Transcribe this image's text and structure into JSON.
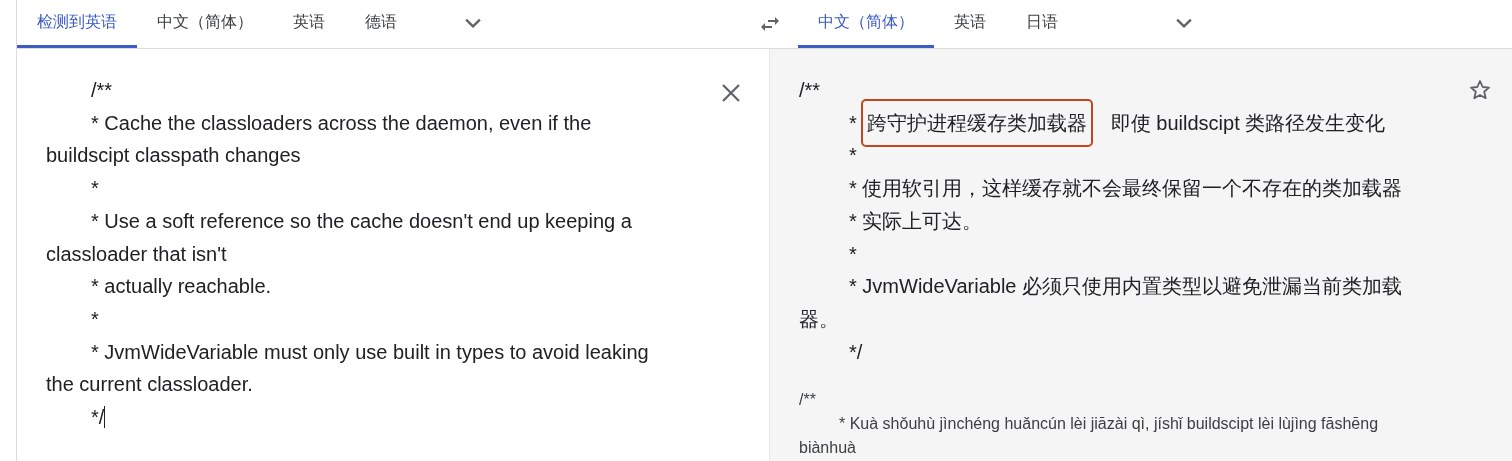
{
  "source_tabs": [
    {
      "label": "检测到英语",
      "selected": true
    },
    {
      "label": "中文（简体）",
      "selected": false
    },
    {
      "label": "英语",
      "selected": false
    },
    {
      "label": "德语",
      "selected": false
    }
  ],
  "target_tabs": [
    {
      "label": "中文（简体）",
      "selected": true
    },
    {
      "label": "英语",
      "selected": false
    },
    {
      "label": "日语",
      "selected": false
    }
  ],
  "source_text": {
    "lines": [
      {
        "text": "/**",
        "indent": true
      },
      {
        "text": "* Cache the classloaders across the daemon, even if the",
        "indent": true
      },
      {
        "text": "buildscipt classpath changes",
        "indent": false
      },
      {
        "text": "*",
        "indent": true
      },
      {
        "text": "* Use a soft reference so the cache doesn't end up keeping a",
        "indent": true
      },
      {
        "text": "classloader that isn't",
        "indent": false
      },
      {
        "text": "* actually reachable.",
        "indent": true
      },
      {
        "text": "*",
        "indent": true
      },
      {
        "text": "* JvmWideVariable must only use built in types to avoid leaking",
        "indent": true
      },
      {
        "text": "the current classloader.",
        "indent": false
      },
      {
        "text": "*/",
        "indent": true
      }
    ]
  },
  "translation": {
    "lines": [
      {
        "indent": false,
        "parts": [
          {
            "text": "/**",
            "highlighted": false
          }
        ]
      },
      {
        "indent": true,
        "parts": [
          {
            "text": "*",
            "highlighted": false
          },
          {
            "text": "跨守护进程缓存类加载器",
            "highlighted": true
          },
          {
            "text": "即使 buildscipt 类路径发生变化",
            "highlighted": false
          }
        ]
      },
      {
        "indent": true,
        "parts": [
          {
            "text": "*",
            "highlighted": false
          }
        ]
      },
      {
        "indent": true,
        "parts": [
          {
            "text": "* 使用软引用，这样缓存就不会最终保留一个不存在的类加载器",
            "highlighted": false
          }
        ]
      },
      {
        "indent": true,
        "parts": [
          {
            "text": "* 实际上可达。",
            "highlighted": false
          }
        ]
      },
      {
        "indent": true,
        "parts": [
          {
            "text": "*",
            "highlighted": false
          }
        ]
      },
      {
        "indent": true,
        "parts": [
          {
            "text": "* JvmWideVariable 必须只使用内置类型以避免泄漏当前类加载",
            "highlighted": false
          }
        ]
      },
      {
        "indent": false,
        "parts": [
          {
            "text": "器。",
            "highlighted": false
          }
        ]
      },
      {
        "indent": true,
        "parts": [
          {
            "text": "*/",
            "highlighted": false
          }
        ]
      }
    ],
    "romanization": {
      "lines": [
        {
          "text": "/**",
          "indent": false
        },
        {
          "text": "* Kuà shǒuhù jìnchéng huǎncún lèi jiāzài qì, jíshǐ buildscipt lèi lùjìng fāshēng",
          "indent": true
        },
        {
          "text": "biànhuà",
          "indent": false
        }
      ]
    }
  }
}
